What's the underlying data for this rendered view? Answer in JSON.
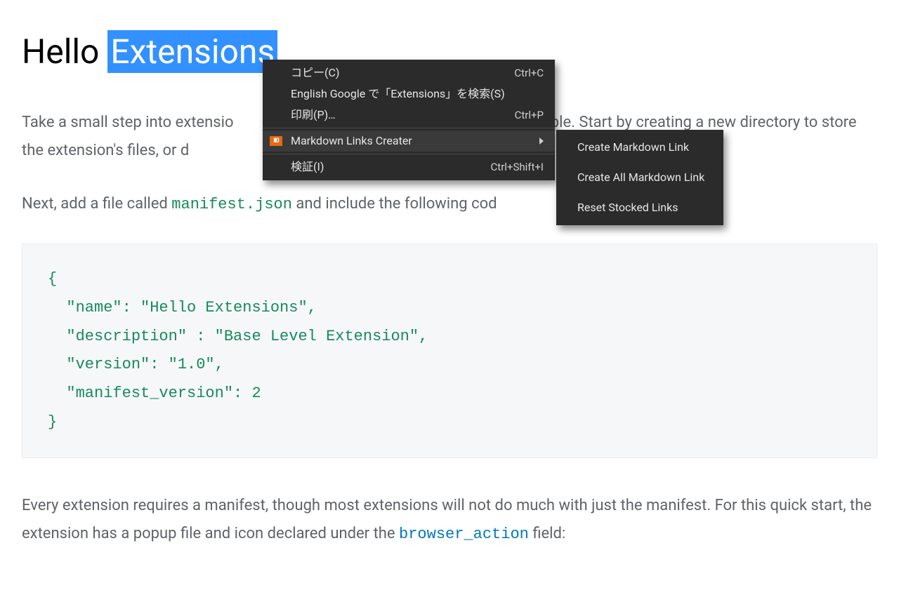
{
  "heading": {
    "before": "Hello ",
    "selected": "Extensions"
  },
  "para1_before": "Take a small step into extensio",
  "para1_after": "mple. Start by creating a new directory to store the extension's files, or d",
  "para2_before": "Next, add a file called ",
  "para2_code": "manifest.json",
  "para2_after": " and include the following cod",
  "code_block": "{\n  \"name\": \"Hello Extensions\",\n  \"description\" : \"Base Level Extension\",\n  \"version\": \"1.0\",\n  \"manifest_version\": 2\n}",
  "para3_a": "Every extension requires a manifest, though most extensions will not do much with just the manifest. For this quick start, the extension has a popup file and icon declared under the ",
  "para3_code": "browser_action",
  "para3_b": " field:",
  "context_menu": {
    "copy": {
      "label": "コピー(C)",
      "shortcut": "Ctrl+C"
    },
    "search": {
      "label": "English Google で「Extensions」を検索(S)"
    },
    "print": {
      "label": "印刷(P)…",
      "shortcut": "Ctrl+P"
    },
    "mlc": {
      "label": "Markdown Links Creater"
    },
    "inspect": {
      "label": "検証(I)",
      "shortcut": "Ctrl+Shift+I"
    }
  },
  "submenu": {
    "create": "Create Markdown Link",
    "create_all": "Create All Markdown Link",
    "reset": "Reset Stocked Links"
  }
}
